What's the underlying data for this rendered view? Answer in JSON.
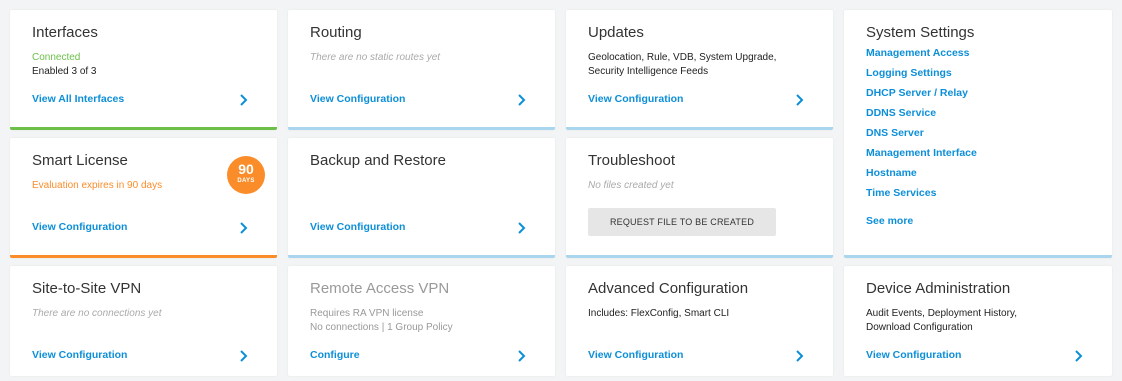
{
  "interfaces": {
    "title": "Interfaces",
    "status": "Connected",
    "enabled": "Enabled 3 of 3",
    "link": "View All Interfaces"
  },
  "routing": {
    "title": "Routing",
    "note": "There are no static routes yet",
    "link": "View Configuration"
  },
  "updates": {
    "title": "Updates",
    "line1": "Geolocation, Rule, VDB, System Upgrade,",
    "line2": "Security Intelligence Feeds",
    "link": "View Configuration"
  },
  "system_settings": {
    "title": "System Settings",
    "items": [
      "Management Access",
      "Logging Settings",
      "DHCP Server / Relay",
      "DDNS Service",
      "DNS Server",
      "Management Interface",
      "Hostname",
      "Time Services"
    ],
    "see_more": "See more"
  },
  "smart_license": {
    "title": "Smart License",
    "note": "Evaluation expires in 90 days",
    "badge_num": "90",
    "badge_unit": "DAYS",
    "link": "View Configuration"
  },
  "backup": {
    "title": "Backup and Restore",
    "link": "View Configuration"
  },
  "troubleshoot": {
    "title": "Troubleshoot",
    "note": "No files created yet",
    "button": "REQUEST FILE TO BE CREATED"
  },
  "s2s_vpn": {
    "title": "Site-to-Site VPN",
    "note": "There are no connections yet",
    "link": "View Configuration"
  },
  "ra_vpn": {
    "title": "Remote Access VPN",
    "line1": "Requires RA VPN license",
    "line2": "No connections | 1 Group Policy",
    "link": "Configure"
  },
  "advanced": {
    "title": "Advanced Configuration",
    "line1": "Includes: FlexConfig, Smart CLI",
    "link": "View Configuration"
  },
  "device_admin": {
    "title": "Device Administration",
    "line1": "Audit Events, Deployment History,",
    "line2": "Download Configuration",
    "link": "View Configuration"
  },
  "colors": {
    "link": "#0d8fd8",
    "green": "#6cc04a",
    "orange": "#fb8c2a",
    "blue_accent": "#a9d5ee"
  },
  "icons": {
    "chevron": "chevron-right-icon"
  }
}
